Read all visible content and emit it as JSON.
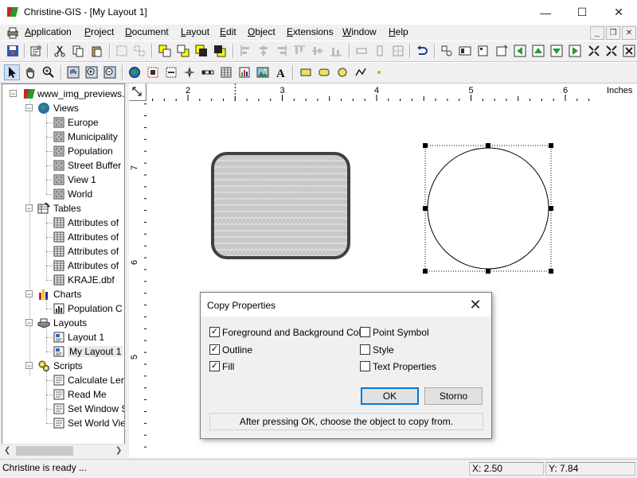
{
  "window": {
    "title": "Christine-GIS - [My Layout 1]",
    "minimize_glyph": "—",
    "maximize_glyph": "☐",
    "close_glyph": "✕"
  },
  "menu": {
    "items": [
      {
        "label": "Application",
        "accel": "A",
        "rest": "pplication"
      },
      {
        "label": "Project",
        "accel": "P",
        "rest": "roject"
      },
      {
        "label": "Document",
        "accel": "D",
        "rest": "ocument"
      },
      {
        "label": "Layout",
        "accel": "L",
        "rest": "ayout"
      },
      {
        "label": "Edit",
        "accel": "E",
        "rest": "dit"
      },
      {
        "label": "Object",
        "accel": "O",
        "rest": "bject"
      },
      {
        "label": "Extensions",
        "accel": "E",
        "rest": "xtensions"
      },
      {
        "label": "Window",
        "accel": "W",
        "rest": "indow"
      },
      {
        "label": "Help",
        "accel": "H",
        "rest": "elp"
      }
    ],
    "mdi_minimize": "_",
    "mdi_restore": "❐",
    "mdi_close": "✕"
  },
  "tree": {
    "root": "www_img_previews.",
    "groups": [
      {
        "label": "Views",
        "icon": "globe-icon",
        "children": [
          "Europe",
          "Municipality",
          "Population",
          "Street Buffer",
          "View 1",
          "World"
        ]
      },
      {
        "label": "Tables",
        "icon": "table-pen-icon",
        "children": [
          "Attributes of",
          "Attributes of",
          "Attributes of",
          "Attributes of",
          "KRAJE.dbf"
        ]
      },
      {
        "label": "Charts",
        "icon": "bar-chart-icon",
        "children": [
          "Population C"
        ]
      },
      {
        "label": "Layouts",
        "icon": "printer-icon",
        "children": [
          "Layout 1",
          "My Layout 1"
        ]
      },
      {
        "label": "Scripts",
        "icon": "gears-icon",
        "children": [
          "Calculate Len",
          "Read Me",
          "Set Window S",
          "Set World Vie"
        ]
      }
    ]
  },
  "ruler": {
    "units": "Inches",
    "h_ticks": [
      "2",
      "3",
      "4",
      "5",
      "6"
    ],
    "v_ticks": [
      "7",
      "6",
      "5"
    ]
  },
  "dialog": {
    "title": "Copy Properties",
    "close_glyph": "✕",
    "checkboxes_left": [
      {
        "label": "Foreground and Background Color",
        "checked": true
      },
      {
        "label": "Outline",
        "checked": true
      },
      {
        "label": "Fill",
        "checked": true
      }
    ],
    "checkboxes_right": [
      {
        "label": "Point Symbol",
        "checked": false
      },
      {
        "label": "Style",
        "checked": false
      },
      {
        "label": "Text Properties",
        "checked": false
      }
    ],
    "ok_label": "OK",
    "cancel_label": "Storno",
    "hint": "After pressing OK, choose the object to copy from."
  },
  "status": {
    "message": "Christine is ready ...",
    "x": "X: 2.50",
    "y": "Y: 7.84"
  },
  "colors": {
    "accent": "#0078d7",
    "selection_handle": "#000000",
    "shape_fill": "#c8c8c8",
    "shape_outline": "#404040"
  }
}
